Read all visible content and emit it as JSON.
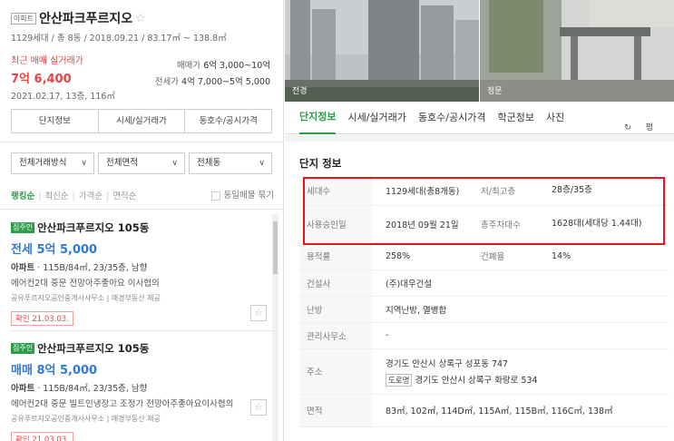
{
  "complex": {
    "type_badge": "아파트",
    "name": "안산파크푸르지오",
    "meta": "1129세대 / 총 8동 / 2018.09.21 / 83.17㎡ ~ 138.8㎡",
    "recent_label": "최근 매매 실거래가",
    "recent_price": "7억 6,400",
    "recent_date": "2021.02.17, 13층, 116㎡",
    "sale_range_label": "매매가",
    "sale_range_value": "6억 3,000~10억",
    "jeonse_range_label": "전세가",
    "jeonse_range_value": "4억 7,000~5억 5,000"
  },
  "left_tabs": [
    "단지정보",
    "시세/실거래가",
    "동호수/공시가격"
  ],
  "filters": {
    "deal": "전체거래방식",
    "area": "전체면적",
    "building": "전체동"
  },
  "sort": {
    "items": [
      "랭킹순",
      "최신순",
      "가격순",
      "면적순"
    ],
    "same_listing": "동일매물 묶기"
  },
  "listings": [
    {
      "badge": "집주인",
      "title": "안산파크푸르지오 105동",
      "price": "전세 5억 5,000",
      "info_type": "아파트",
      "info": "115B/84㎡, 23/35층, 남향",
      "desc": "에어컨2대 중문 전망아주좋아요 이사협의",
      "agent": "공유푸르지오공인중개사사무소 | 매경부동산 제공",
      "confirm": "확인 21.03.03."
    },
    {
      "badge": "집주인",
      "title": "안산파크푸르지오 105동",
      "price": "매매 8억 5,000",
      "info_type": "아파트",
      "info": "115B/84㎡, 23/35층, 남향",
      "desc": "에어컨2대 중문 빌트인냉장고 조정가 전망아주좋아요이사협의",
      "agent": "공유푸르지오공인중개사사무소 | 매경부동산 제공",
      "confirm": "확인 21.03.03."
    }
  ],
  "photos": [
    {
      "caption": "전경"
    },
    {
      "caption": "정문"
    }
  ],
  "right_tabs": [
    "단지정보",
    "시세/실거래가",
    "동호수/공시가격",
    "학군정보",
    "사진"
  ],
  "refresh": "평",
  "info_section": {
    "title": "단지 정보",
    "households_label": "세대수",
    "households": "1129세대(총8개동)",
    "floors_label": "저/최고층",
    "floors": "28층/35층",
    "approval_label": "사용승인일",
    "approval": "2018년 09월 21일",
    "parking_label": "총주차대수",
    "parking": "1628대(세대당 1.44대)",
    "far_label": "용적률",
    "far": "258%",
    "bcr_label": "건폐율",
    "bcr": "14%",
    "builder_label": "건설사",
    "builder": "(주)대우건설",
    "heating_label": "난방",
    "heating": "지역난방, 열병합",
    "office_label": "관리사무소",
    "office": "-",
    "address_label": "주소",
    "address": "경기도 안산시 상록구 성포동 747",
    "road_badge": "도로명",
    "road_address": "경기도 안산시 상록구 화랑로 534",
    "area_label": "면적",
    "areas": "83㎡, 102㎡, 114D㎡, 115A㎡, 115B㎡, 116C㎡, 138㎡"
  }
}
